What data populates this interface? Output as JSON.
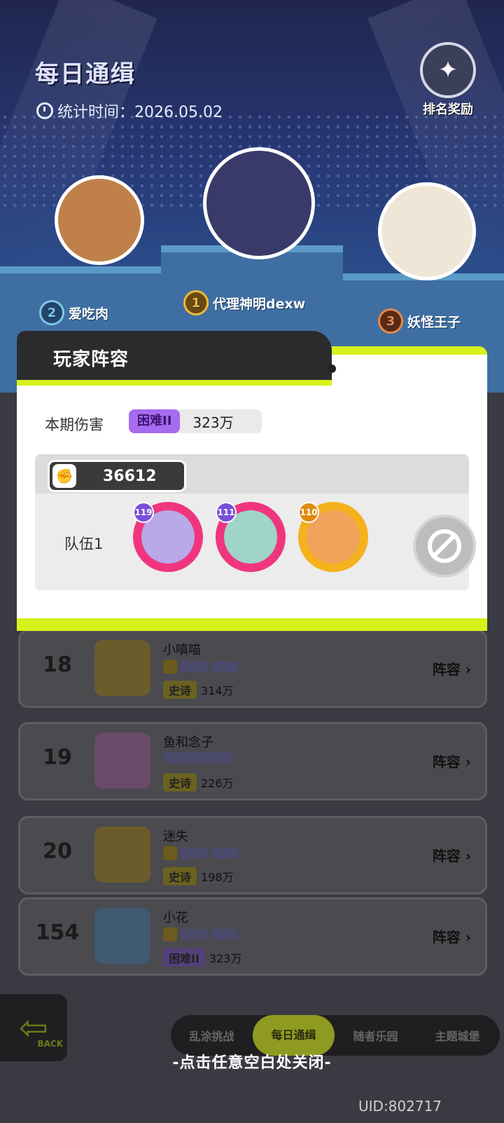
{
  "header": {
    "title": "每日通缉",
    "stat_label": "统计时间：2026.05.02",
    "rank_reward_label": "排名奖励"
  },
  "podium": [
    {
      "place": "2",
      "name": "爱吃肉",
      "color": "#7fc6e8"
    },
    {
      "place": "1",
      "name": "代理神明dexw",
      "color": "#f2b93b"
    },
    {
      "place": "3",
      "name": "妖怪王子",
      "color": "#e7894b"
    }
  ],
  "ranking": [
    {
      "rank": "18",
      "name": "小嗔喵",
      "difficulty": "史诗",
      "damage": "314万",
      "lineup_label": "阵容"
    },
    {
      "rank": "19",
      "name": "鱼和念子",
      "difficulty": "史诗",
      "damage": "226万",
      "lineup_label": "阵容"
    },
    {
      "rank": "20",
      "name": "迷失",
      "difficulty": "史诗",
      "damage": "198万",
      "lineup_label": "阵容"
    },
    {
      "rank": "154",
      "name": "小花",
      "difficulty": "困难II",
      "damage": "323万",
      "lineup_label": "阵容"
    }
  ],
  "modal": {
    "title": "玩家阵容",
    "damage_label": "本期伤害",
    "difficulty": "困难II",
    "damage_value": "323万",
    "power": "36612",
    "team_label": "队伍1",
    "heroes": [
      {
        "level": "119",
        "border": "#f0357f",
        "face": "#b9a9e8"
      },
      {
        "level": "111",
        "border": "#f0357f",
        "face": "#9fd4c8"
      },
      {
        "level": "110",
        "border": "#f5b11e",
        "face": "#f0a35a"
      }
    ]
  },
  "nav": {
    "back_label": "BACK",
    "tabs": [
      "乱涂挑战",
      "每日通缉",
      "随者乐园",
      "主题城堡"
    ]
  },
  "close_hint": "-点击任意空白处关闭-",
  "uid": "UID:802717",
  "colors": {
    "accent": "#d7f21a",
    "hard": "#a76bf0"
  }
}
